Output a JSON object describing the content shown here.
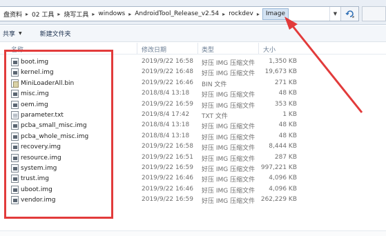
{
  "address_bar": {
    "crumbs": [
      "盘资料",
      "02 工具",
      "烧写工具",
      "windows",
      "AndroidTool_Release_v2.54",
      "rockdev"
    ],
    "current": "Image"
  },
  "toolbar": {
    "share_label": "共享",
    "new_folder_label": "新建文件夹"
  },
  "columns": {
    "name": "名称",
    "date": "修改日期",
    "type": "类型",
    "size": "大小"
  },
  "files": [
    {
      "name": "boot.img",
      "date": "2019/9/22 16:58",
      "type": "好压 IMG 压缩文件",
      "size": "1,350 KB",
      "icon": "img-file-icon"
    },
    {
      "name": "kernel.img",
      "date": "2019/9/22 16:48",
      "type": "好压 IMG 压缩文件",
      "size": "19,673 KB",
      "icon": "img-file-icon"
    },
    {
      "name": "MiniLoaderAll.bin",
      "date": "2019/9/22 16:46",
      "type": "BIN 文件",
      "size": "271 KB",
      "icon": "bin-file-icon"
    },
    {
      "name": "misc.img",
      "date": "2018/8/4 13:18",
      "type": "好压 IMG 压缩文件",
      "size": "48 KB",
      "icon": "img-file-icon"
    },
    {
      "name": "oem.img",
      "date": "2019/9/22 16:59",
      "type": "好压 IMG 压缩文件",
      "size": "353 KB",
      "icon": "img-file-icon"
    },
    {
      "name": "parameter.txt",
      "date": "2019/8/4 17:42",
      "type": "TXT 文件",
      "size": "1 KB",
      "icon": "txt-file-icon"
    },
    {
      "name": "pcba_small_misc.img",
      "date": "2018/8/4 13:18",
      "type": "好压 IMG 压缩文件",
      "size": "48 KB",
      "icon": "img-file-icon"
    },
    {
      "name": "pcba_whole_misc.img",
      "date": "2018/8/4 13:18",
      "type": "好压 IMG 压缩文件",
      "size": "48 KB",
      "icon": "img-file-icon"
    },
    {
      "name": "recovery.img",
      "date": "2019/9/22 16:58",
      "type": "好压 IMG 压缩文件",
      "size": "8,444 KB",
      "icon": "img-file-icon"
    },
    {
      "name": "resource.img",
      "date": "2019/9/22 16:51",
      "type": "好压 IMG 压缩文件",
      "size": "287 KB",
      "icon": "img-file-icon"
    },
    {
      "name": "system.img",
      "date": "2019/9/22 16:59",
      "type": "好压 IMG 压缩文件",
      "size": "997,221 KB",
      "icon": "img-file-icon"
    },
    {
      "name": "trust.img",
      "date": "2019/9/22 16:46",
      "type": "好压 IMG 压缩文件",
      "size": "4,096 KB",
      "icon": "img-file-icon"
    },
    {
      "name": "uboot.img",
      "date": "2019/9/22 16:46",
      "type": "好压 IMG 压缩文件",
      "size": "4,096 KB",
      "icon": "img-file-icon"
    },
    {
      "name": "vendor.img",
      "date": "2019/9/22 16:59",
      "type": "好压 IMG 压缩文件",
      "size": "262,229 KB",
      "icon": "img-file-icon"
    }
  ],
  "colors": {
    "annotation_red": "#e23b3b",
    "current_crumb_bg": "#d4e3f3"
  }
}
